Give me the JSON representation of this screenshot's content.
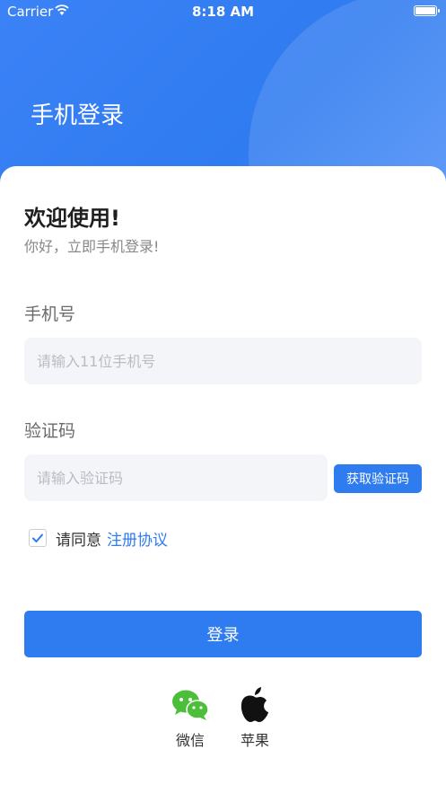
{
  "status_bar": {
    "carrier": "Carrier",
    "time": "8:18 AM"
  },
  "header": {
    "title": "手机登录"
  },
  "welcome": {
    "title": "欢迎使用!",
    "subtitle": "你好，立即手机登录!"
  },
  "phone": {
    "label": "手机号",
    "placeholder": "请输入11位手机号",
    "value": ""
  },
  "code": {
    "label": "验证码",
    "placeholder": "请输入验证码",
    "value": "",
    "button": "获取验证码"
  },
  "agreement": {
    "checked": true,
    "text": "请同意",
    "link": "注册协议"
  },
  "login_button": "登录",
  "social": [
    {
      "icon": "wechat-icon",
      "label": "微信"
    },
    {
      "icon": "apple-icon",
      "label": "苹果"
    }
  ],
  "colors": {
    "primary": "#2f7bf0",
    "wechat": "#4cbf3a",
    "input_bg": "#f3f5f8"
  }
}
